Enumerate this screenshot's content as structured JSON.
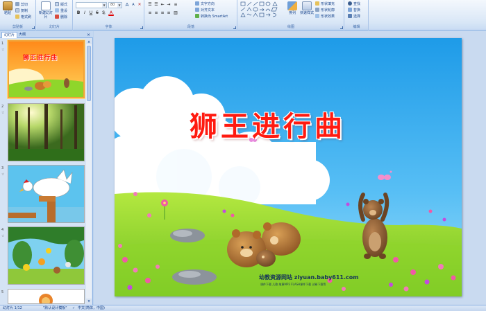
{
  "ribbon": {
    "clipboard": {
      "label": "剪贴板",
      "paste": "粘贴",
      "cut": "剪切",
      "copy": "复制",
      "format_painter": "格式刷"
    },
    "slides": {
      "label": "幻灯片",
      "new_slide": "新建幻灯片",
      "layout": "版式",
      "reset": "重设",
      "delete": "删除"
    },
    "font": {
      "label": "字体",
      "font_value": "",
      "size_value": "80",
      "bold": "B",
      "italic": "I",
      "underline": "U",
      "strike": "S",
      "shadow": "S"
    },
    "paragraph": {
      "label": "段落",
      "text_direction": "文字方向",
      "align_text": "对齐文本",
      "convert_smartart": "转换为 SmartArt"
    },
    "drawing": {
      "label": "绘图",
      "arrange": "排列",
      "quick_styles": "快速样式",
      "shape_fill": "形状填充",
      "shape_outline": "形状轮廓",
      "shape_effects": "形状效果"
    },
    "editing": {
      "label": "编辑",
      "find": "查找",
      "replace": "替换",
      "select": "选择"
    }
  },
  "panel": {
    "tab_slides": "幻灯片",
    "tab_outline": "大纲",
    "thumbnails": [
      {
        "number": "1",
        "title": "狮王进行曲"
      },
      {
        "number": "2"
      },
      {
        "number": "3"
      },
      {
        "number": "4"
      },
      {
        "number": "5"
      }
    ]
  },
  "slide": {
    "title": "狮王进行曲",
    "site_name": "幼教资源网站  ziyuan.baby611.com",
    "site_sub": "课件下载  儿歌  故事MP3  FLASH课件下载  试卷下载等"
  },
  "status": {
    "slide_info": "幻灯片 1/12",
    "theme": "\"默认设计模板\"",
    "language": "中文(简体，中国)"
  },
  "colors": {
    "title": "#ff1a10",
    "sky_top": "#1e9be8",
    "grass": "#8fd62b",
    "ribbon_text": "#15428b",
    "selection": "#f1a43a"
  }
}
